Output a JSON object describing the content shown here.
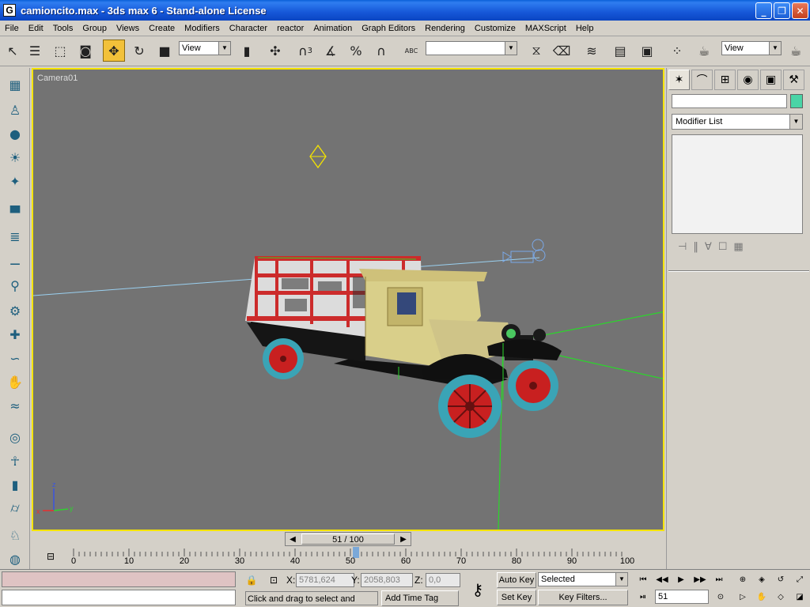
{
  "window": {
    "app_icon": "G",
    "title": "camioncito.max - 3ds max 6 - Stand-alone License",
    "buttons": [
      "minimize-icon",
      "restore-icon",
      "close-icon"
    ]
  },
  "menu": [
    "File",
    "Edit",
    "Tools",
    "Group",
    "Views",
    "Create",
    "Modifiers",
    "Character",
    "reactor",
    "Animation",
    "Graph Editors",
    "Rendering",
    "Customize",
    "MAXScript",
    "Help"
  ],
  "toolbar": {
    "ref_coord": "View",
    "named_selection": "",
    "render_type": "View",
    "snap_labels": [
      "3",
      "%"
    ],
    "abc_label": "ABC"
  },
  "viewport": {
    "label": "Camera01",
    "axis_labels": {
      "z": "z",
      "x": "x",
      "y": "y"
    },
    "colors": {
      "background": "#737373",
      "border": "#f5e400",
      "grid_green": "#2bd62b",
      "camera_line": "#9ad0f0"
    }
  },
  "command_panel": {
    "tabs": [
      "create-icon",
      "modify-icon",
      "hierarchy-icon",
      "motion-icon",
      "display-icon",
      "utilities-icon"
    ],
    "object_name": "",
    "object_color": "#4ad4a6",
    "modifier_list": "Modifier List"
  },
  "time_slider": {
    "current": 51,
    "total": 100,
    "label": "51 / 100"
  },
  "track_bar": {
    "ticks": [
      0,
      10,
      20,
      30,
      40,
      50,
      60,
      70,
      80,
      90,
      100
    ]
  },
  "status": {
    "x_label": "X:",
    "x_value": "5781,624",
    "y_label": "Y:",
    "y_value": "2058,803",
    "z_label": "Z:",
    "z_value": "0,0",
    "prompt": "Click and drag to select and move",
    "add_time_tag": "Add Time Tag",
    "auto_key": "Auto Key",
    "set_key": "Set Key",
    "key_mode": "Selected",
    "key_filters": "Key Filters...",
    "current_frame": "51"
  }
}
